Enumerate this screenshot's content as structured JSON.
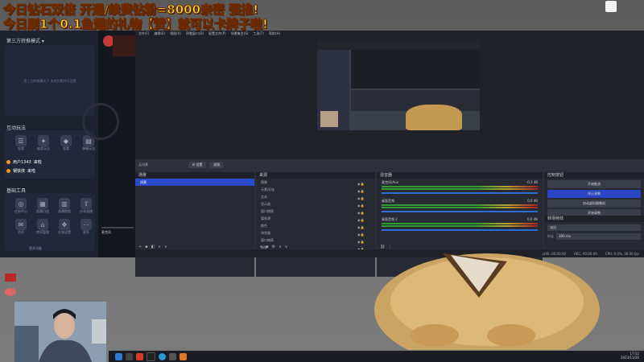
{
  "banners": {
    "line1": "今日钻石双倍 开通/续费钻粉=8000亲密 强推!",
    "line2": "今日刷1个0.1鱼翅的礼物【赞】就可以卡牌子啦!"
  },
  "left_panel": {
    "mode_title": "第三方转推模式 ▾",
    "empty_text": "第三方转推模式下 未找到素材可设置",
    "interactive_title": "互动玩法",
    "interactive_items": [
      "投票",
      "抽奖玩法",
      "竞猜",
      "弹幕玩法"
    ],
    "user1": "用户1343",
    "user1_action": "来啦",
    "user2": "钢铁侠",
    "user2_action": "来啦",
    "basic_tools_title": "基础工具",
    "basic_tools": [
      "任务中心",
      "直播日程",
      "直播数据",
      "分享直播",
      "消息",
      "房间管理",
      "礼物设置",
      "更多"
    ],
    "more_label": "更多功能",
    "bottom_text": "您已经下线"
  },
  "mid_panel": {
    "nick": "萨卡",
    "bottom_text": "麦克风"
  },
  "obs": {
    "menu": [
      "文件(F)",
      "编辑(E)",
      "视图(V)",
      "停靠窗口(D)",
      "配置文件(P)",
      "场景集合(S)",
      "工具(T)",
      "帮助(H)"
    ],
    "toolbar": {
      "scene_label": "无场景",
      "settings_btn": "⚙ 设置",
      "filters_btn": "滤镜"
    },
    "scenes": {
      "header": "场景",
      "items": [
        "场景"
      ]
    },
    "sources": {
      "header": "来源",
      "items": [
        "图像",
        "元素/好友",
        "文本",
        "显示器",
        "窗口捕获",
        "媒体源",
        "颜色",
        "浏览器",
        "窗口捕获",
        "场景",
        "视频捕获设备"
      ]
    },
    "mixer": {
      "header": "混音器",
      "channels": [
        {
          "name": "麦克风/Aux",
          "db": "-0.3 dB"
        },
        {
          "name": "桌面音频",
          "db": "0.0 dB"
        },
        {
          "name": "桌面音频 2",
          "db": "0.0 dB"
        }
      ]
    },
    "controls": {
      "header": "控制按钮",
      "buttons": [
        "开始推流",
        "停止录制",
        "启动虚拟摄像机",
        "开始录制",
        "工作室模式",
        "设置",
        "退出"
      ]
    },
    "transitions": {
      "header": "转场特效",
      "type": "淡出",
      "duration_label": "时长",
      "duration": "300 ms"
    },
    "status": {
      "live": "LIVE: 00:00:00",
      "rec": "REC: 00:00:00",
      "cpu": "CPU: 0.0%, 30.00 fps"
    }
  },
  "taskbar": {
    "time": "17:52",
    "date": "2023/11/26"
  },
  "colors": {
    "banner_text": "#ffe03a",
    "obs_selection": "#2a4ac9",
    "panel_bg": "#1e2130"
  }
}
